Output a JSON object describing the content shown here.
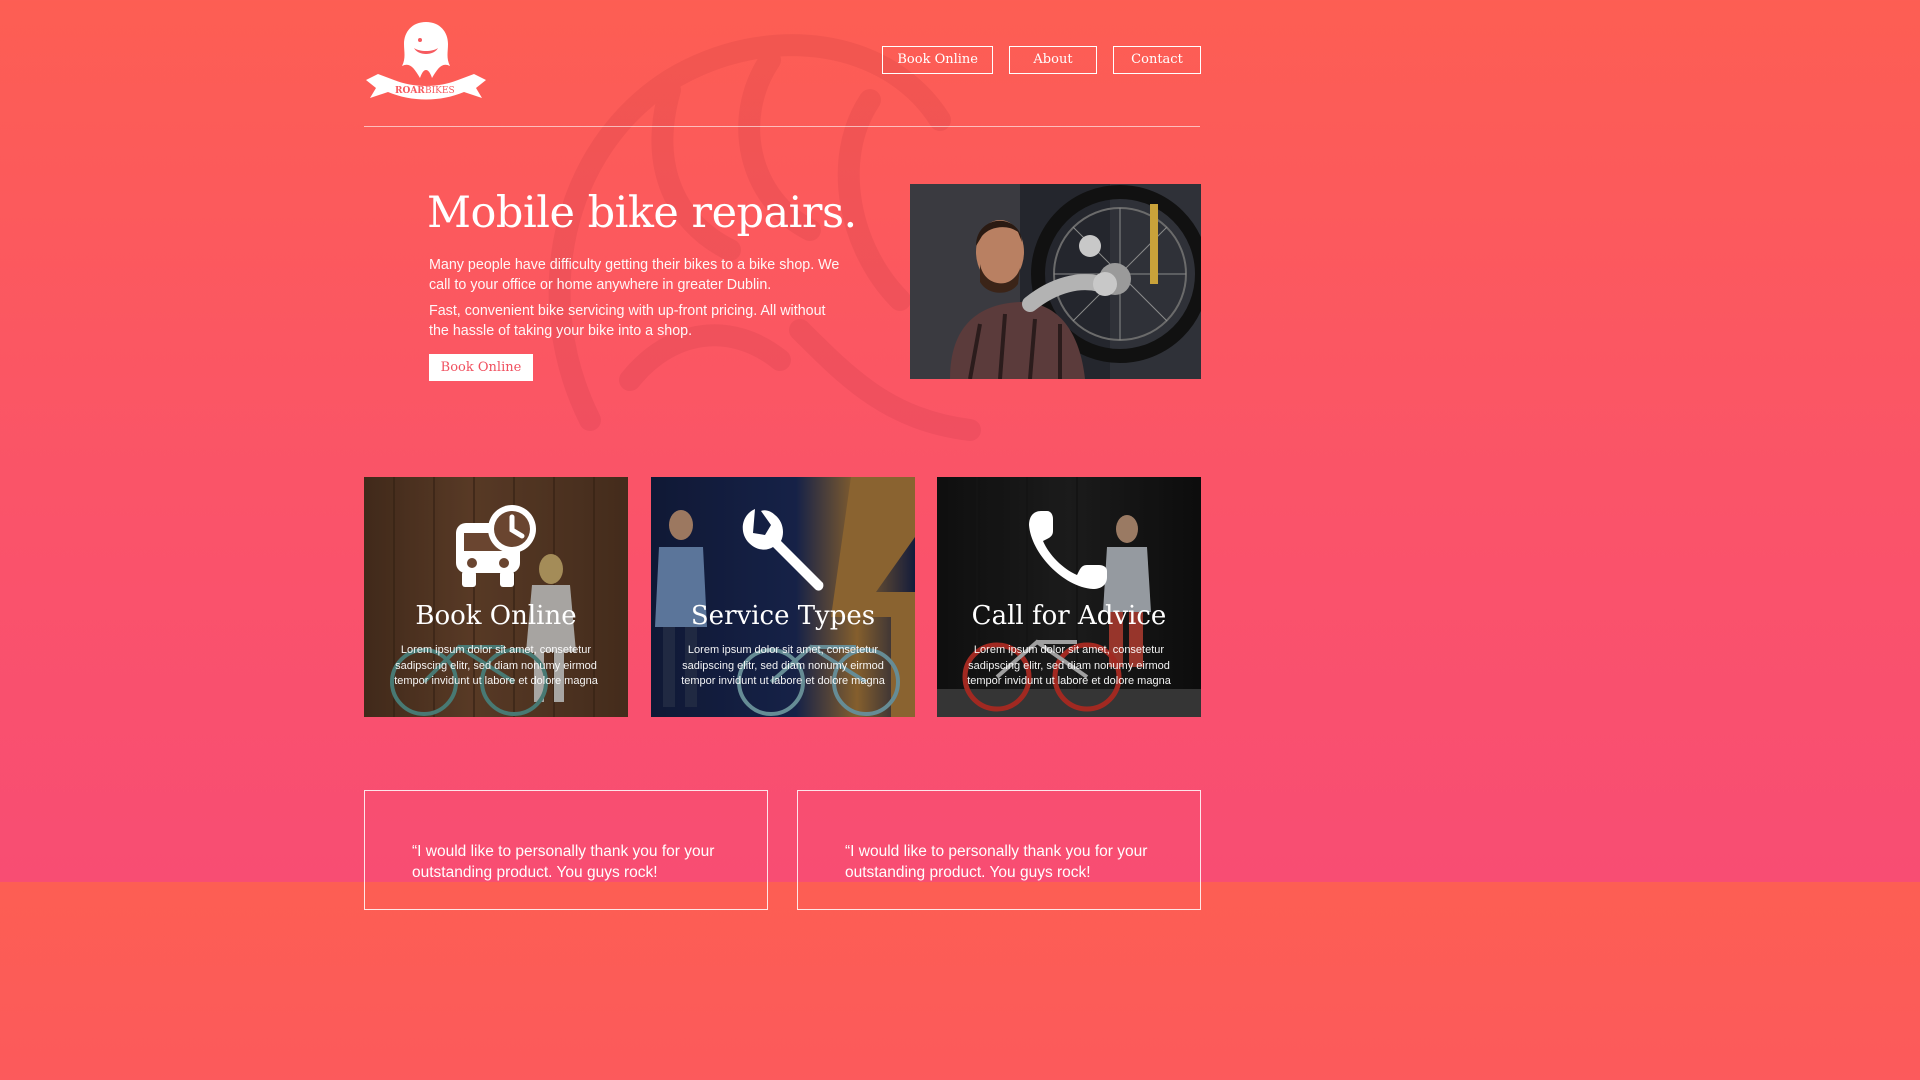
{
  "brand": {
    "logo_text_1": "ROAR",
    "logo_text_2": "BIKES"
  },
  "nav": {
    "items": [
      "Book Online",
      "About",
      "Contact"
    ]
  },
  "hero": {
    "title": "Mobile bike repairs.",
    "paragraph_1": "Many people have difficulty getting their bikes to a bike shop. We call to your office or home anywhere in greater Dublin.",
    "paragraph_2": "Fast, convenient bike servicing with up-front pricing. All without the hassle of taking your bike into a shop.",
    "cta_label": "Book Online"
  },
  "cards": [
    {
      "title": "Book Online",
      "icon": "bus-clock-icon",
      "text": "Lorem ipsum dolor sit amet, consetetur sadipscing elitr, sed diam nonumy eirmod tempor invidunt ut labore et dolore magna"
    },
    {
      "title": "Service Types",
      "icon": "wrench-icon",
      "text": "Lorem ipsum dolor sit amet, consetetur sadipscing elitr, sed diam nonumy eirmod tempor invidunt ut labore et dolore magna"
    },
    {
      "title": "Call for Advice",
      "icon": "phone-icon",
      "text": "Lorem ipsum dolor sit amet, consetetur sadipscing elitr, sed diam nonumy eirmod tempor invidunt ut labore et dolore magna"
    }
  ],
  "testimonials": [
    {
      "quote": "“I would like to personally thank you for your outstanding product. You guys rock!"
    },
    {
      "quote": "“I would like to personally thank you for your outstanding product. You guys rock!"
    }
  ],
  "colors": {
    "gradient_top": "#fd5e53",
    "gradient_bottom": "#f84d73",
    "accent_text": "#f0505f"
  }
}
